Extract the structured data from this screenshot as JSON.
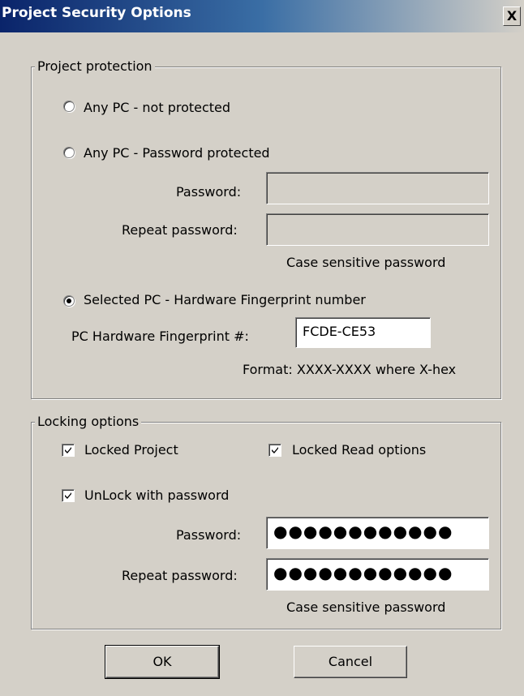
{
  "window": {
    "title": "Project Security Options",
    "close_label": "X"
  },
  "protection": {
    "group_title": "Project protection",
    "options": [
      {
        "label": "Any PC - not protected",
        "selected": false
      },
      {
        "label": "Any PC - Password protected",
        "selected": false
      },
      {
        "label": "Selected PC - Hardware Fingerprint number",
        "selected": true
      }
    ],
    "password_label": "Password:",
    "password_value": "",
    "repeat_password_label": "Repeat password:",
    "repeat_password_value": "",
    "case_note": "Case sensitive password",
    "fingerprint_label": "PC Hardware Fingerprint #:",
    "fingerprint_value": "FCDE-CE53",
    "format_note": "Format:  XXXX-XXXX  where X-hex"
  },
  "locking": {
    "group_title": "Locking options",
    "locked_project_label": "Locked Project",
    "locked_project_checked": true,
    "locked_read_label": "Locked Read options",
    "locked_read_checked": true,
    "unlock_label": "UnLock with password",
    "unlock_checked": true,
    "password_label": "Password:",
    "password_value": "●●●●●●●●●●●●",
    "repeat_password_label": "Repeat password:",
    "repeat_password_value": "●●●●●●●●●●●●",
    "case_note": "Case sensitive password"
  },
  "buttons": {
    "ok_label": "OK",
    "cancel_label": "Cancel"
  }
}
